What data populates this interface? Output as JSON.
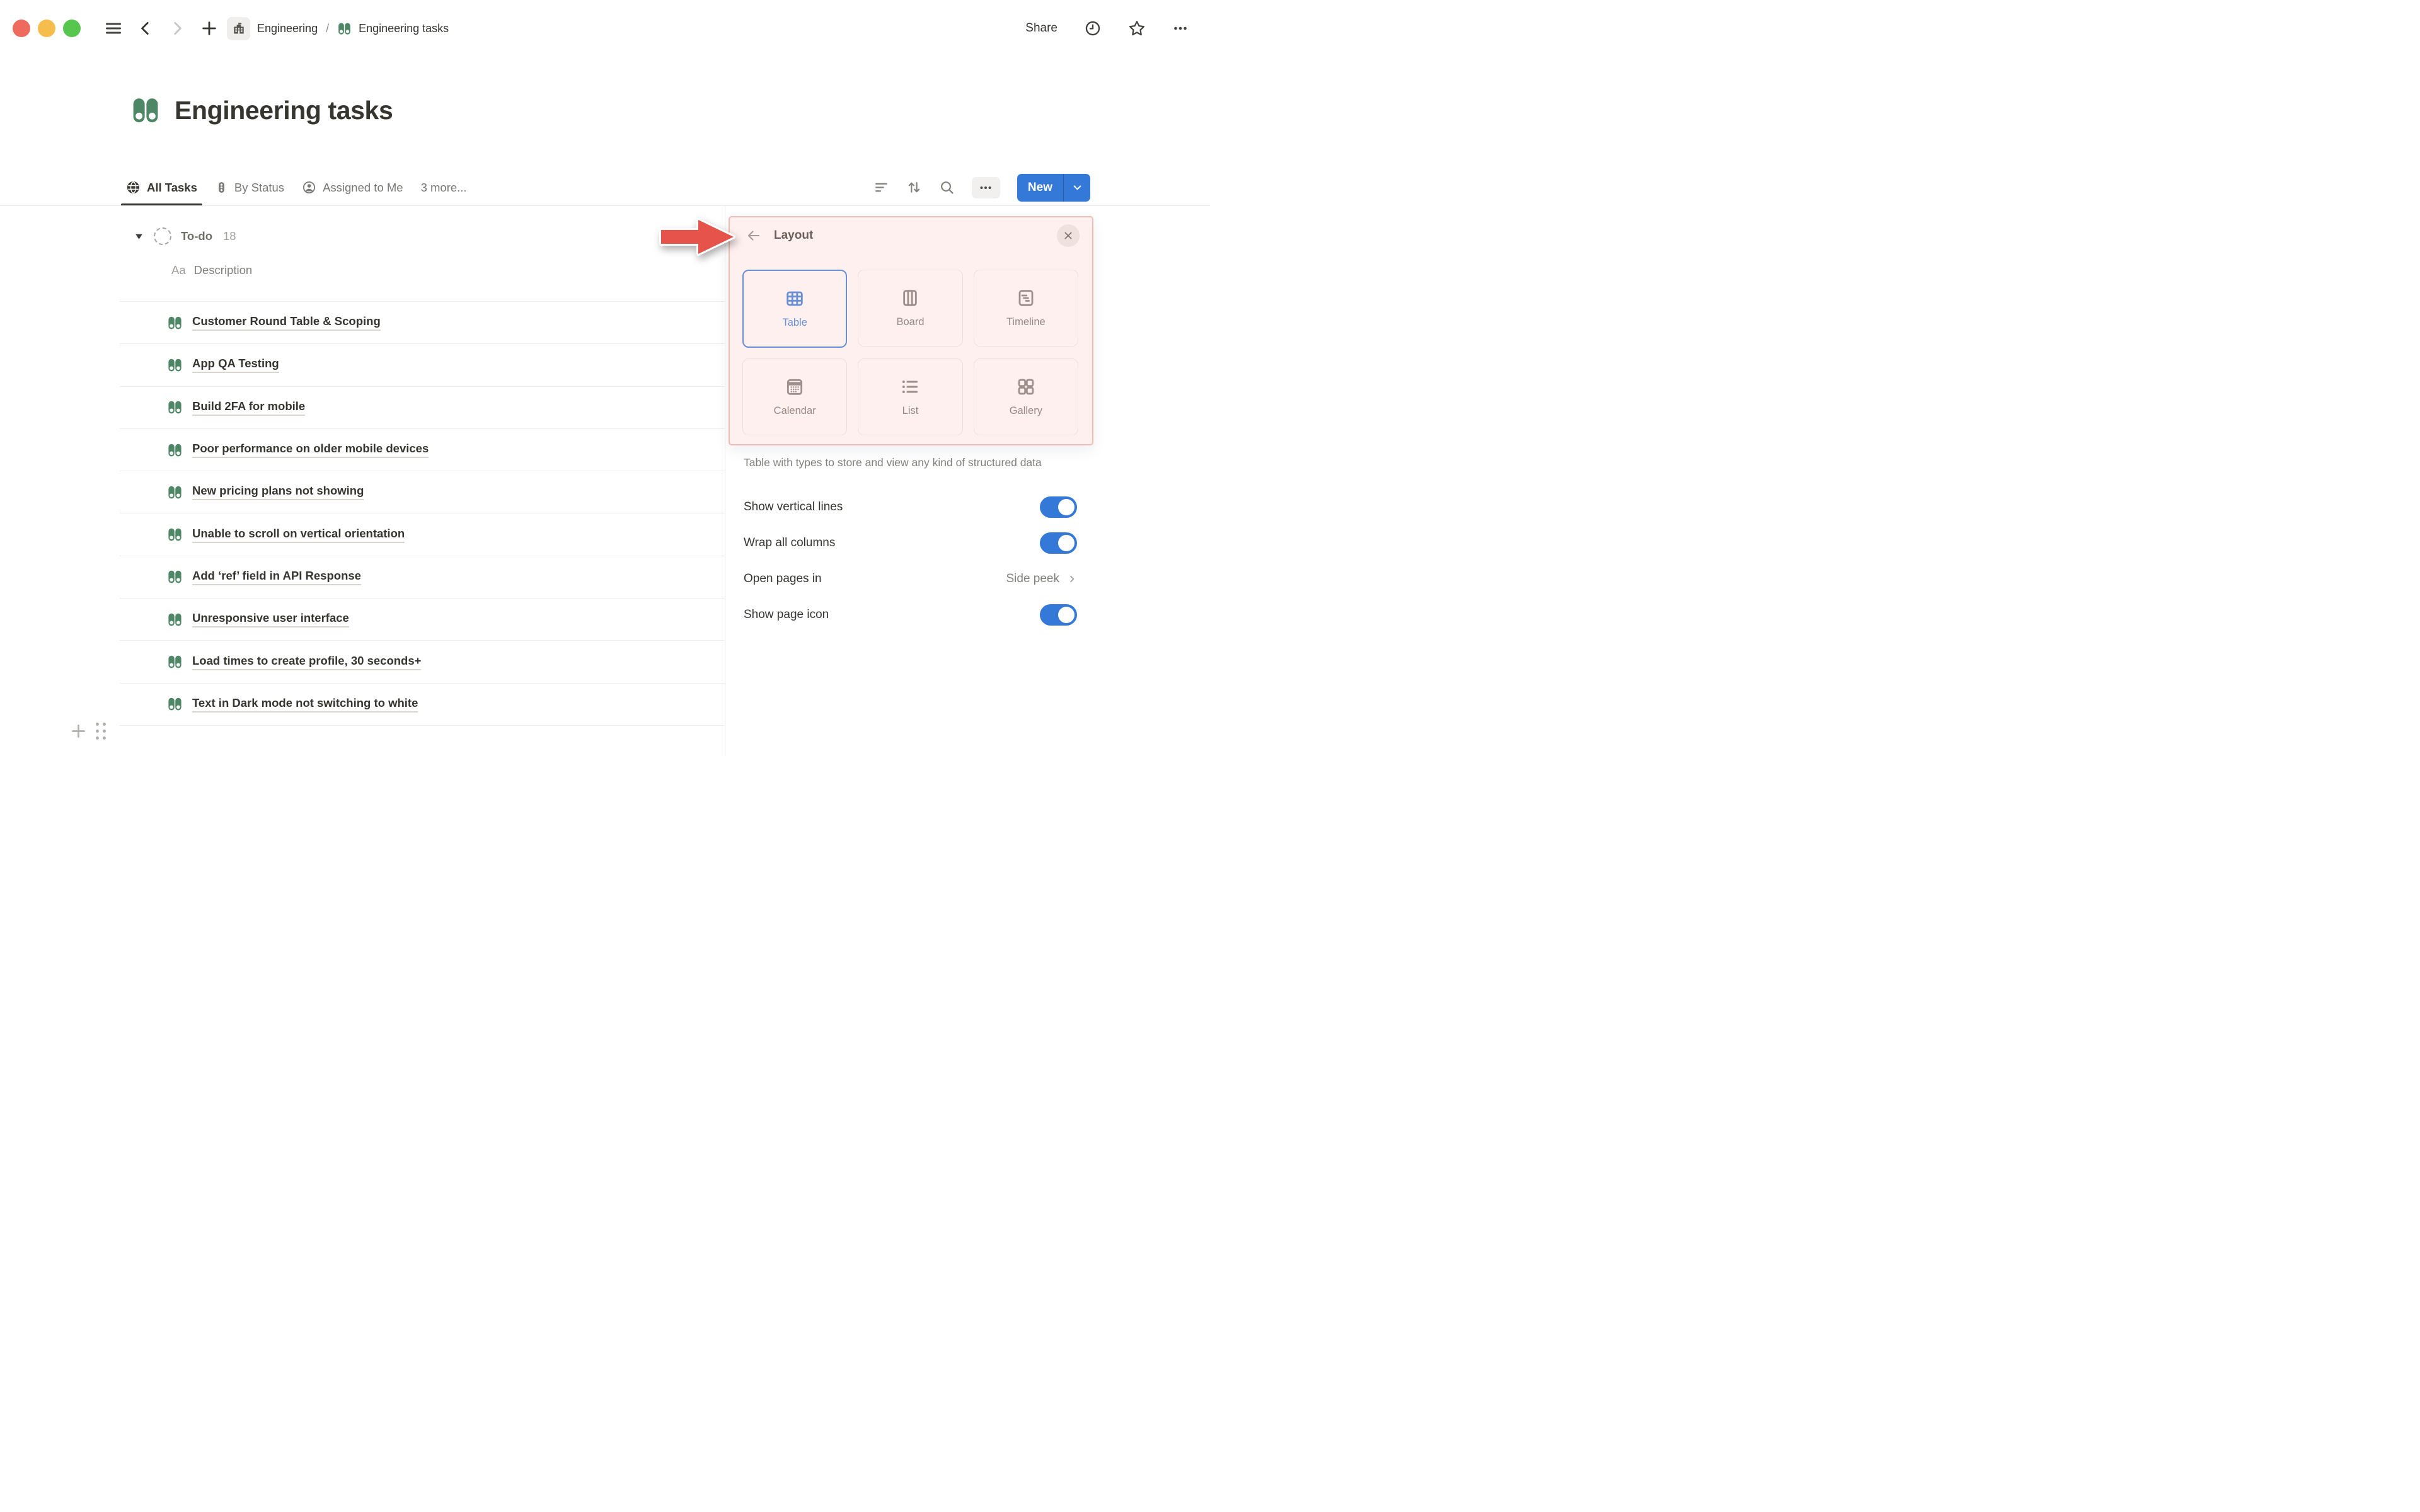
{
  "topbar": {
    "breadcrumb": {
      "workspace": "Engineering",
      "separator": "/",
      "page": "Engineering tasks"
    },
    "share_label": "Share"
  },
  "page": {
    "title": "Engineering tasks"
  },
  "toolbar": {
    "tabs": [
      {
        "label": "All Tasks",
        "icon": "globe",
        "active": true
      },
      {
        "label": "By Status",
        "icon": "traffic-light",
        "active": false
      },
      {
        "label": "Assigned to Me",
        "icon": "person",
        "active": false
      },
      {
        "label": "3 more...",
        "icon": "none",
        "active": false
      }
    ],
    "new_button_label": "New"
  },
  "table": {
    "group": {
      "name": "To-do",
      "count": "18"
    },
    "column_header": {
      "icon": "Aa",
      "label": "Description"
    },
    "rows": [
      "Customer Round Table & Scoping",
      "App QA Testing",
      "Build 2FA for mobile",
      "Poor performance on older mobile devices",
      "New pricing plans not showing",
      "Unable to scroll on vertical orientation",
      "Add ‘ref’ field in API Response",
      "Unresponsive user interface",
      "Load times to create profile, 30 seconds+",
      "Text in Dark mode not switching to white"
    ]
  },
  "layout_panel": {
    "title": "Layout",
    "options": [
      {
        "label": "Table",
        "selected": true
      },
      {
        "label": "Board",
        "selected": false
      },
      {
        "label": "Timeline",
        "selected": false
      },
      {
        "label": "Calendar",
        "selected": false
      },
      {
        "label": "List",
        "selected": false
      },
      {
        "label": "Gallery",
        "selected": false
      }
    ],
    "description": "Table with types to store and view any kind of structured data",
    "settings": [
      {
        "label": "Show vertical lines",
        "type": "toggle",
        "value": true
      },
      {
        "label": "Wrap all columns",
        "type": "toggle",
        "value": true
      },
      {
        "label": "Open pages in",
        "type": "select",
        "value": "Side peek"
      },
      {
        "label": "Show page icon",
        "type": "toggle",
        "value": true
      }
    ]
  },
  "colors": {
    "accent_blue": "#3478d8",
    "icon_green": "#4e8765",
    "annotation_red": "#e5534b",
    "annotation_pink_border": "#f2bcb6",
    "traffic_red": "#ee6a5e",
    "traffic_yellow": "#f5bd4b",
    "traffic_green": "#57c64e"
  }
}
